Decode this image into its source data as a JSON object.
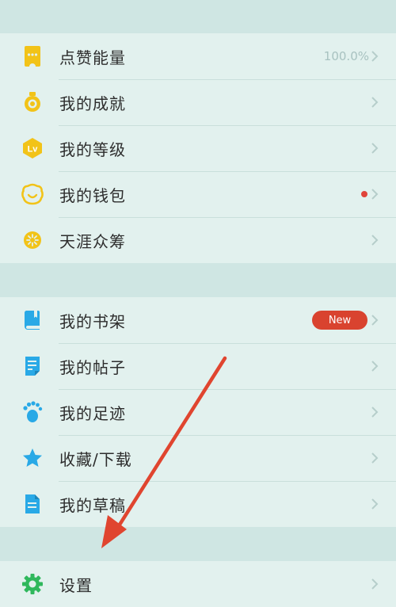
{
  "group1": [
    {
      "label": "点赞能量",
      "value": "100.0%",
      "icon": "energy-ticket-icon"
    },
    {
      "label": "我的成就",
      "icon": "medal-icon"
    },
    {
      "label": "我的等级",
      "icon": "level-lv-icon"
    },
    {
      "label": "我的钱包",
      "icon": "wallet-face-icon"
    },
    {
      "label": "天涯众筹",
      "icon": "crowdfund-flower-icon"
    }
  ],
  "group2": [
    {
      "label": "我的书架",
      "badge": "New",
      "icon": "bookshelf-icon"
    },
    {
      "label": "我的帖子",
      "icon": "posts-document-icon"
    },
    {
      "label": "我的足迹",
      "icon": "footprint-icon"
    },
    {
      "label": "收藏/下载",
      "icon": "star-icon"
    },
    {
      "label": "我的草稿",
      "icon": "draft-document-icon"
    }
  ],
  "group3": [
    {
      "label": "设置",
      "icon": "gear-icon"
    }
  ],
  "colors": {
    "background": "#cfe6e3",
    "row": "#e2f1ee",
    "accent_red": "#d9432f",
    "icon_yellow": "#f2c318",
    "icon_blue": "#29a9e6",
    "icon_green": "#2fb85c"
  }
}
